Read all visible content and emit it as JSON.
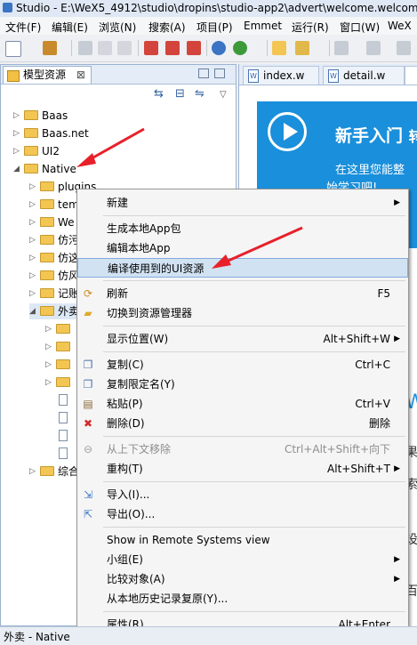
{
  "title_bar": {
    "text": "Studio - E:\\WeX5_4912\\studio\\dropins\\studio-app2\\advert\\welcome.welcome"
  },
  "menu_bar": [
    "文件(F)",
    "编辑(E)",
    "浏览(N)",
    "搜索(A)",
    "项目(P)",
    "Emmet",
    "运行(R)",
    "窗口(W)",
    "WeX"
  ],
  "left_panel": {
    "tab_label": "模型资源",
    "close_glyph": "⊠",
    "tools": [
      "⇆",
      "⊟",
      "⇋",
      "▽"
    ],
    "tree": [
      {
        "label": "Baas",
        "twisty": "▷",
        "indent": 0,
        "type": "folder"
      },
      {
        "label": "Baas.net",
        "twisty": "▷",
        "indent": 0,
        "type": "folder"
      },
      {
        "label": "UI2",
        "twisty": "▷",
        "indent": 0,
        "type": "folder"
      },
      {
        "label": "Native",
        "twisty": "◢",
        "indent": 0,
        "type": "folder"
      },
      {
        "label": "plugins",
        "twisty": "▷",
        "indent": 1,
        "type": "folder"
      },
      {
        "label": "tem",
        "twisty": "▷",
        "indent": 1,
        "type": "folder"
      },
      {
        "label": "We",
        "twisty": "▷",
        "indent": 1,
        "type": "folder"
      },
      {
        "label": "仿污",
        "twisty": "▷",
        "indent": 1,
        "type": "folder"
      },
      {
        "label": "仿这",
        "twisty": "▷",
        "indent": 1,
        "type": "folder"
      },
      {
        "label": "仿风",
        "twisty": "▷",
        "indent": 1,
        "type": "folder"
      },
      {
        "label": "记账",
        "twisty": "▷",
        "indent": 1,
        "type": "folder"
      },
      {
        "label": "外卖",
        "twisty": "◢",
        "indent": 1,
        "type": "folder"
      },
      {
        "label": "",
        "twisty": "▷",
        "indent": 2,
        "type": "folder"
      },
      {
        "label": "",
        "twisty": "▷",
        "indent": 2,
        "type": "folder"
      },
      {
        "label": "",
        "twisty": "▷",
        "indent": 2,
        "type": "folder"
      },
      {
        "label": "",
        "twisty": "▷",
        "indent": 2,
        "type": "folder"
      },
      {
        "label": "",
        "twisty": "",
        "indent": 2,
        "type": "file"
      },
      {
        "label": "",
        "twisty": "",
        "indent": 2,
        "type": "file"
      },
      {
        "label": "",
        "twisty": "",
        "indent": 2,
        "type": "file"
      },
      {
        "label": "",
        "twisty": "",
        "indent": 2,
        "type": "file"
      },
      {
        "label": "综合",
        "twisty": "▷",
        "indent": 1,
        "type": "folder"
      }
    ]
  },
  "editor_tabs": [
    "index.w",
    "detail.w"
  ],
  "editor_tab_icon": "W",
  "banner": {
    "title": "新手入门",
    "title_more": "转",
    "line1": "在这里您能整",
    "line2": "始学习吧!"
  },
  "edge_glyphs": [
    "W",
    "果",
    "索",
    "设",
    "百"
  ],
  "context_menu": {
    "items": [
      {
        "label": "新建",
        "shortcut": "",
        "submenu": true,
        "enabled": true,
        "icon": ""
      },
      {
        "sep": true
      },
      {
        "label": "生成本地App包",
        "shortcut": "",
        "submenu": false,
        "enabled": true,
        "icon": ""
      },
      {
        "label": "编辑本地App",
        "shortcut": "",
        "submenu": false,
        "enabled": true,
        "icon": ""
      },
      {
        "label": "编译使用到的UI资源",
        "shortcut": "",
        "submenu": false,
        "enabled": true,
        "icon": "",
        "highlighted": true
      },
      {
        "sep": true
      },
      {
        "label": "刷新",
        "shortcut": "F5",
        "submenu": false,
        "enabled": true,
        "icon": "refresh-icon"
      },
      {
        "label": "切换到资源管理器",
        "shortcut": "",
        "submenu": false,
        "enabled": true,
        "icon": "folder-icon"
      },
      {
        "sep": true
      },
      {
        "label": "显示位置(W)",
        "shortcut": "Alt+Shift+W",
        "submenu": true,
        "enabled": true,
        "icon": ""
      },
      {
        "sep": true
      },
      {
        "label": "复制(C)",
        "shortcut": "Ctrl+C",
        "submenu": false,
        "enabled": true,
        "icon": "copy-icon"
      },
      {
        "label": "复制限定名(Y)",
        "shortcut": "",
        "submenu": false,
        "enabled": true,
        "icon": "copy-qualified-icon"
      },
      {
        "label": "粘贴(P)",
        "shortcut": "Ctrl+V",
        "submenu": false,
        "enabled": true,
        "icon": "paste-icon"
      },
      {
        "label": "删除(D)",
        "shortcut": "删除",
        "submenu": false,
        "enabled": true,
        "icon": "delete-icon"
      },
      {
        "sep": true
      },
      {
        "label": "从上下文移除",
        "shortcut": "Ctrl+Alt+Shift+向下",
        "submenu": false,
        "enabled": false,
        "icon": "remove-context-icon"
      },
      {
        "label": "重构(T)",
        "shortcut": "Alt+Shift+T",
        "submenu": true,
        "enabled": true,
        "icon": ""
      },
      {
        "sep": true
      },
      {
        "label": "导入(I)...",
        "shortcut": "",
        "submenu": false,
        "enabled": true,
        "icon": "import-icon"
      },
      {
        "label": "导出(O)...",
        "shortcut": "",
        "submenu": false,
        "enabled": true,
        "icon": "export-icon"
      },
      {
        "sep": true
      },
      {
        "label": "Show in Remote Systems view",
        "shortcut": "",
        "submenu": false,
        "enabled": true,
        "icon": ""
      },
      {
        "label": "小组(E)",
        "shortcut": "",
        "submenu": true,
        "enabled": true,
        "icon": ""
      },
      {
        "label": "比较对象(A)",
        "shortcut": "",
        "submenu": true,
        "enabled": true,
        "icon": ""
      },
      {
        "label": "从本地历史记录复原(Y)...",
        "shortcut": "",
        "submenu": false,
        "enabled": true,
        "icon": ""
      },
      {
        "sep": true
      },
      {
        "label": "属性(R)",
        "shortcut": "Alt+Enter",
        "submenu": false,
        "enabled": true,
        "icon": ""
      }
    ]
  },
  "status_bar": {
    "text": "外卖 - Native"
  },
  "colors": {
    "banner_blue": "#1a8fdb",
    "highlight": "#d1e2f2",
    "arrow_red": "#e8202a",
    "folder": "#f3c552"
  }
}
